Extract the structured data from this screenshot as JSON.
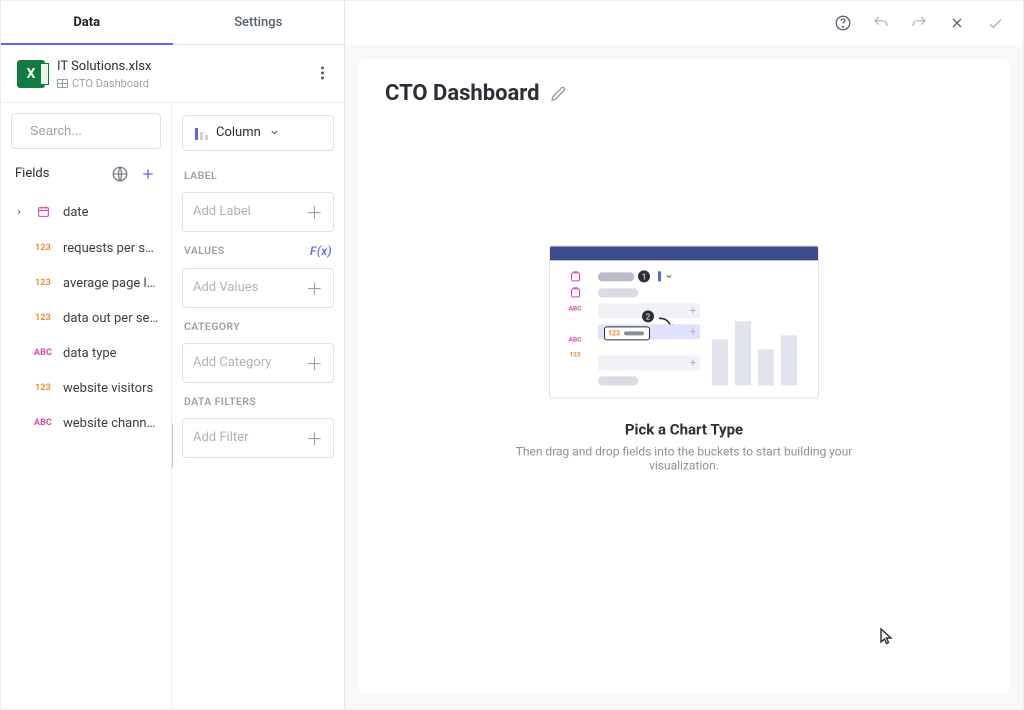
{
  "tabs": {
    "data": "Data",
    "settings": "Settings"
  },
  "file": {
    "name": "IT Solutions.xlsx",
    "sheet": "CTO Dashboard"
  },
  "search": {
    "placeholder": "Search..."
  },
  "fieldsHeader": "Fields",
  "fields": [
    {
      "type": "date",
      "label": "date",
      "expandable": true
    },
    {
      "type": "num",
      "label": "requests per se…"
    },
    {
      "type": "num",
      "label": "average page lo…"
    },
    {
      "type": "num",
      "label": "data out per sec…"
    },
    {
      "type": "abc",
      "label": "data type"
    },
    {
      "type": "num",
      "label": "website visitors"
    },
    {
      "type": "abc",
      "label": "website channels"
    }
  ],
  "chartType": "Column",
  "buckets": {
    "label": {
      "title": "LABEL",
      "placeholder": "Add Label"
    },
    "values": {
      "title": "VALUES",
      "placeholder": "Add Values",
      "fx": "F(x)"
    },
    "category": {
      "title": "CATEGORY",
      "placeholder": "Add Category"
    },
    "filters": {
      "title": "DATA FILTERS",
      "placeholder": "Add Filter"
    }
  },
  "dashboard": {
    "title": "CTO Dashboard"
  },
  "empty": {
    "heading": "Pick a Chart Type",
    "body": "Then drag and drop fields into the buckets to start building your visualization."
  }
}
